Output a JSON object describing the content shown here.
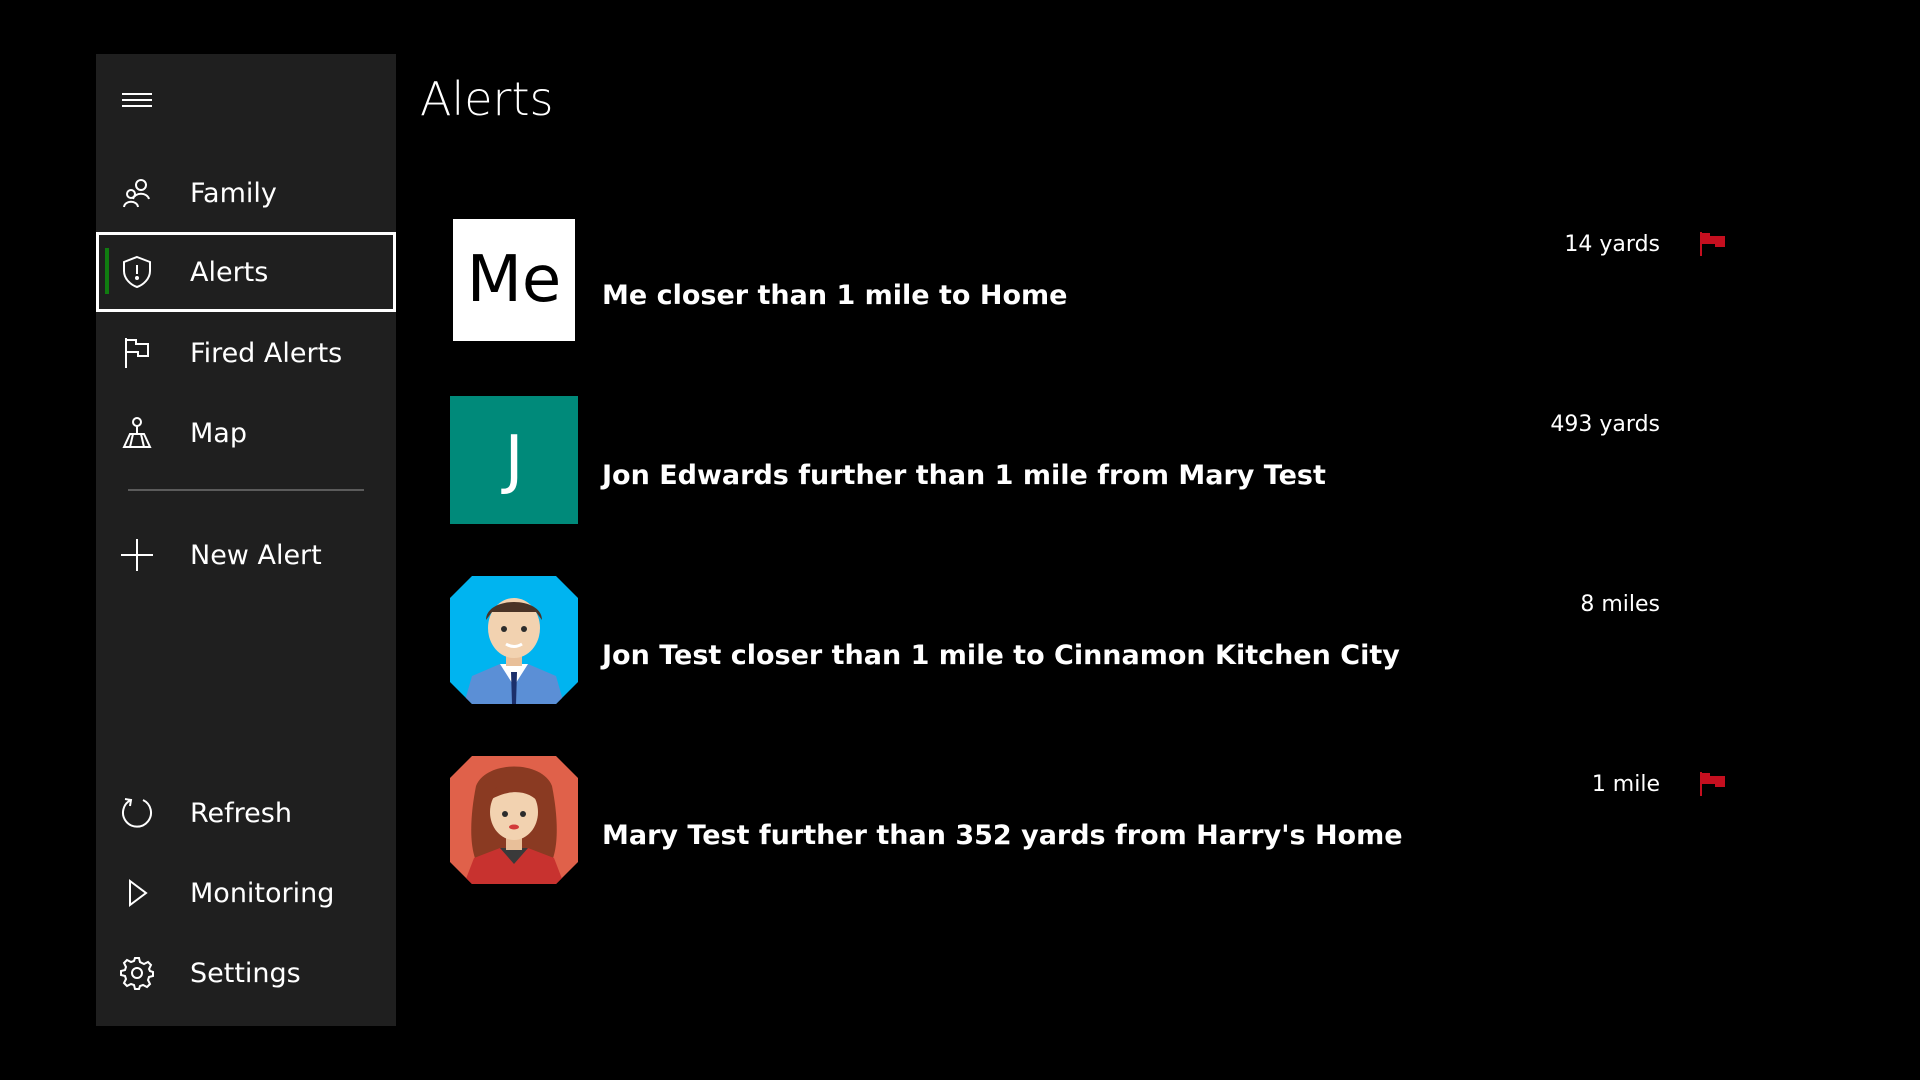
{
  "page": {
    "title": "Alerts"
  },
  "sidebar": {
    "items": [
      {
        "label": "Family",
        "icon": "family-icon"
      },
      {
        "label": "Alerts",
        "icon": "shield-icon",
        "selected": true
      },
      {
        "label": "Fired Alerts",
        "icon": "flag-outline-icon"
      },
      {
        "label": "Map",
        "icon": "map-icon"
      }
    ],
    "new_alert": {
      "label": "New Alert",
      "icon": "plus-icon"
    },
    "bottom": [
      {
        "label": "Refresh",
        "icon": "refresh-icon"
      },
      {
        "label": "Monitoring",
        "icon": "play-icon"
      },
      {
        "label": "Settings",
        "icon": "gear-icon"
      }
    ]
  },
  "alerts": [
    {
      "avatar_text": "Me",
      "avatar_type": "initials-white",
      "text": "Me closer than 1 mile to Home",
      "distance": "14 yards",
      "fired": true
    },
    {
      "avatar_text": "J",
      "avatar_type": "initials-teal",
      "avatar_color": "#008a7a",
      "text": "Jon Edwards further than 1 mile from Mary Test",
      "distance": "493 yards",
      "fired": false
    },
    {
      "avatar_type": "male-avatar-image",
      "text": "Jon Test closer than 1 mile to Cinnamon Kitchen City",
      "distance": "8 miles",
      "fired": false
    },
    {
      "avatar_type": "female-avatar-image",
      "text": "Mary Test further than 352 yards from Harry's Home",
      "distance": "1 mile",
      "fired": true
    }
  ],
  "colors": {
    "accent": "#107c10",
    "flag": "#c50f1f",
    "sidebar_bg": "#1f1f1f",
    "teal_avatar": "#008a7a"
  }
}
